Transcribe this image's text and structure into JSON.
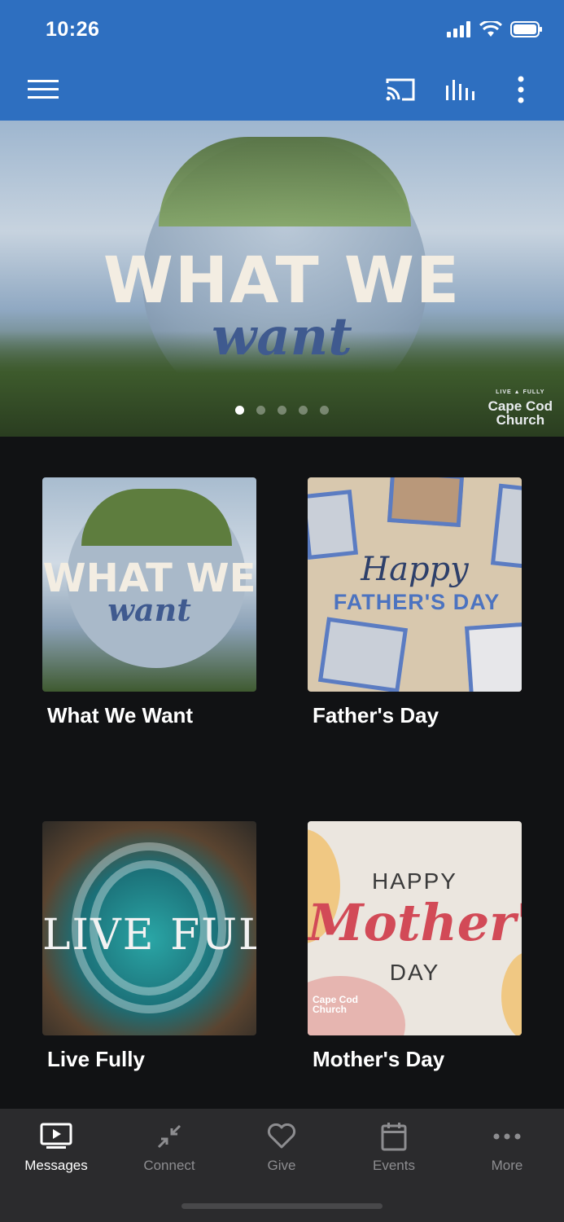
{
  "status_bar": {
    "time": "10:26"
  },
  "toolbar": {
    "menu_icon": "hamburger-menu-icon",
    "cast_icon": "cast-icon",
    "audio_icon": "audio-bars-icon",
    "overflow_icon": "more-vertical-icon"
  },
  "hero": {
    "title": "WHAT WE",
    "script": "want",
    "logo_line1": "Cape Cod",
    "logo_line2": "Church",
    "logo_small_left": "LIVE",
    "logo_small_right": "FULLY",
    "active_slide": 1,
    "total_slides": 5
  },
  "cards": [
    {
      "label": "What We Want",
      "art_title": "WHAT WE",
      "art_script": "want"
    },
    {
      "label": "Father's Day",
      "art_title": "Happy",
      "art_script": "FATHER'S DAY"
    },
    {
      "label": "Live Fully",
      "art_title": "LIVE FULLY"
    },
    {
      "label": "Mother's Day",
      "art_top": "HAPPY",
      "art_script": "Mother's",
      "art_bottom": "DAY",
      "art_logo1": "Cape Cod",
      "art_logo2": "Church"
    }
  ],
  "bottom_nav": [
    {
      "label": "Messages",
      "icon": "tv-play-icon",
      "active": true
    },
    {
      "label": "Connect",
      "icon": "arrows-in-icon",
      "active": false
    },
    {
      "label": "Give",
      "icon": "heart-icon",
      "active": false
    },
    {
      "label": "Events",
      "icon": "calendar-icon",
      "active": false
    },
    {
      "label": "More",
      "icon": "more-horizontal-icon",
      "active": false
    }
  ],
  "colors": {
    "primary": "#2e6fc0",
    "background": "#111214",
    "nav_bg": "#2b2b2d"
  }
}
